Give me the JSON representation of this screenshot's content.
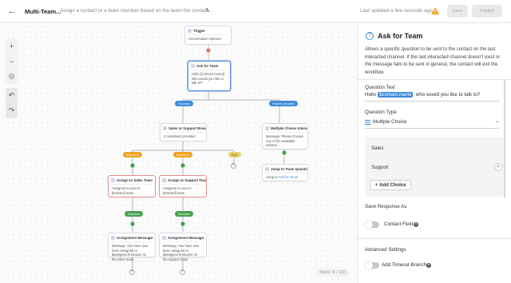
{
  "header": {
    "back_icon": "back-arrow-icon",
    "title": "Multi-Team...",
    "description": "Assign a contact to a team member based on the team the contact...",
    "last_updated": "Last updated a few seconds ago",
    "save_label": "Save",
    "publish_label": "Publish",
    "warning_color": "#f0a21e"
  },
  "canvas": {
    "steps_label": "Steps: 8 / 100",
    "nodes": {
      "trigger": {
        "title": "Trigger",
        "body": "Conversation Opened"
      },
      "ask": {
        "title": "Ask for Team",
        "body": "Hello {{contact.name}}, who would you like to talk to?"
      },
      "branch": {
        "title": "Sales or Support Branch",
        "body": "2 conditions provided"
      },
      "mcq": {
        "title": "Multiple Choice Interacti...",
        "body": "Message: Please choose one of the available options."
      },
      "jump": {
        "title": "Jump to Team Question",
        "body": "Jump to",
        "link": "Ask for Team"
      },
      "sales": {
        "title": "Assign to Sales Team",
        "body": "Assigned to user in [Deleted] team"
      },
      "support": {
        "title": "Assign to Support Team",
        "body": "Assigned to user in [Deleted] team"
      },
      "msg_sales": {
        "title": "Assignment Message: S...",
        "body": "Message: You have now been assigned to $assignee.firstname on the sales team"
      },
      "msg_support": {
        "title": "Assignment Message: S...",
        "body": "Message: You have now been assigned to $assignee.firstname on the support team"
      }
    },
    "pills": {
      "success": "Success",
      "failure": "Failure (Invalid)",
      "branch1": "Branch 1",
      "branch2": "Branch 2",
      "else": "Else",
      "success_sales": "Success",
      "success_support": "Success"
    }
  },
  "panel": {
    "title": "Ask for Team",
    "description": "Allows a specific question to be sent to the contact on the last interacted channel. If the last interacted channel doesn't exist or the message fails to be sent in general, the contact will exit the workflow.",
    "question_text_label": "Question Text",
    "question_prefix": "Hello",
    "question_token": "$contact.name",
    "question_suffix": ", who would you like to talk to?",
    "question_type_label": "Question Type",
    "question_type_value": "Multiple Choice",
    "choices": [
      "Sales",
      "Support"
    ],
    "add_choice_label": "Add Choice",
    "save_response_label": "Save Response As",
    "contact_field_label": "Contact Field",
    "advanced_label": "Advanced Settings",
    "timeout_label": "Add Timeout Branch",
    "accent_color": "#3b8ad9"
  }
}
